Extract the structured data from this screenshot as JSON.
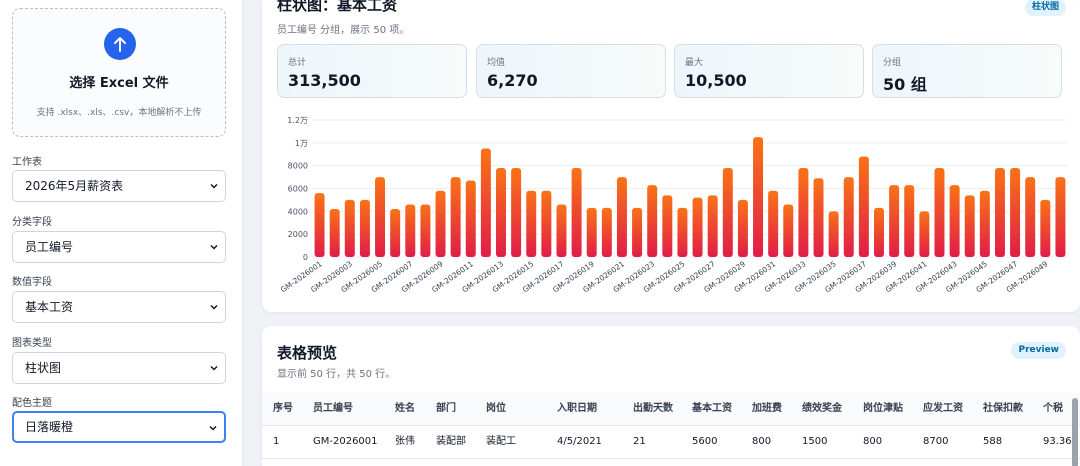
{
  "sidebar": {
    "upload": {
      "title": "选择 Excel 文件",
      "subtitle": "支持 .xlsx、.xls、.csv，本地解析不上传",
      "icon": "upload-arrow-icon",
      "accent": "#2563eb"
    },
    "fields": [
      {
        "label": "工作表",
        "value": "2026年5月薪资表"
      },
      {
        "label": "分类字段",
        "value": "员工编号"
      },
      {
        "label": "数值字段",
        "value": "基本工资"
      },
      {
        "label": "图表类型",
        "value": "柱状图"
      },
      {
        "label": "配色主题",
        "value": "日落暖橙"
      }
    ]
  },
  "chart_panel": {
    "title": "柱状图：基本工资",
    "subtitle": "员工编号 分组，展示 50 项。",
    "badge": "柱状图",
    "stats": [
      {
        "label": "总计",
        "value": "313,500"
      },
      {
        "label": "均值",
        "value": "6,270"
      },
      {
        "label": "最大",
        "value": "10,500"
      },
      {
        "label": "分组",
        "value": "50 组"
      }
    ]
  },
  "chart_data": {
    "type": "bar",
    "title": "",
    "xlabel": "",
    "ylabel": "",
    "ylim": [
      0,
      12000
    ],
    "yticks": [
      0,
      2000,
      4000,
      6000,
      8000,
      10000,
      12000
    ],
    "ytick_labels": [
      "0",
      "2000",
      "4000",
      "6000",
      "8000",
      "1万",
      "1.2万"
    ],
    "categories": [
      "GM-2026001",
      "GM-2026002",
      "GM-2026003",
      "GM-2026004",
      "GM-2026005",
      "GM-2026006",
      "GM-2026007",
      "GM-2026008",
      "GM-2026009",
      "GM-2026010",
      "GM-2026011",
      "GM-2026012",
      "GM-2026013",
      "GM-2026014",
      "GM-2026015",
      "GM-2026016",
      "GM-2026017",
      "GM-2026018",
      "GM-2026019",
      "GM-2026020",
      "GM-2026021",
      "GM-2026022",
      "GM-2026023",
      "GM-2026024",
      "GM-2026025",
      "GM-2026026",
      "GM-2026027",
      "GM-2026028",
      "GM-2026029",
      "GM-2026030",
      "GM-2026031",
      "GM-2026032",
      "GM-2026033",
      "GM-2026034",
      "GM-2026035",
      "GM-2026036",
      "GM-2026037",
      "GM-2026038",
      "GM-2026039",
      "GM-2026040",
      "GM-2026041",
      "GM-2026042",
      "GM-2026043",
      "GM-2026044",
      "GM-2026045",
      "GM-2026046",
      "GM-2026047",
      "GM-2026048",
      "GM-2026049",
      "GM-2026050"
    ],
    "shown_tick_labels": [
      "GM-2026001",
      "GM-2026003",
      "GM-2026005",
      "GM-2026007",
      "GM-2026009",
      "GM-2026011",
      "GM-2026013",
      "GM-2026015",
      "GM-2026017",
      "GM-2026019",
      "GM-2026021",
      "GM-2026023",
      "GM-2026025",
      "GM-2026027",
      "GM-2026029",
      "GM-2026031",
      "GM-2026033",
      "GM-2026035",
      "GM-2026037",
      "GM-2026039",
      "GM-2026041",
      "GM-2026043",
      "GM-2026045",
      "GM-2026047",
      "GM-2026049"
    ],
    "values": [
      5600,
      4200,
      5000,
      5000,
      7000,
      4200,
      4600,
      4600,
      5800,
      7000,
      6700,
      9500,
      7800,
      7800,
      5800,
      5800,
      4600,
      7800,
      4300,
      4300,
      7000,
      4300,
      6300,
      5400,
      4300,
      5200,
      5400,
      7800,
      5000,
      10500,
      5800,
      4600,
      7800,
      6900,
      4000,
      7000,
      8800,
      4300,
      6300,
      6300,
      4000,
      7800,
      6300,
      5400,
      5800,
      7800,
      7800,
      7000,
      5000,
      7000
    ],
    "grid": true,
    "legend": "none",
    "colors": {
      "bar_top": "#f97316",
      "bar_bottom": "#e11d48",
      "grid": "#eceff3"
    }
  },
  "table_panel": {
    "title": "表格预览",
    "subtitle": "显示前 50 行，共 50 行。",
    "badge": "Preview",
    "columns": [
      "序号",
      "员工编号",
      "姓名",
      "部门",
      "岗位",
      "入职日期",
      "出勤天数",
      "基本工资",
      "加班费",
      "绩效奖金",
      "岗位津贴",
      "应发工资",
      "社保扣款",
      "个税"
    ],
    "rows": [
      [
        "1",
        "GM-2026001",
        "张伟",
        "装配部",
        "装配工",
        "4/5/2021",
        "21",
        "5600",
        "800",
        "1500",
        "800",
        "8700",
        "588",
        "93.36"
      ]
    ]
  }
}
